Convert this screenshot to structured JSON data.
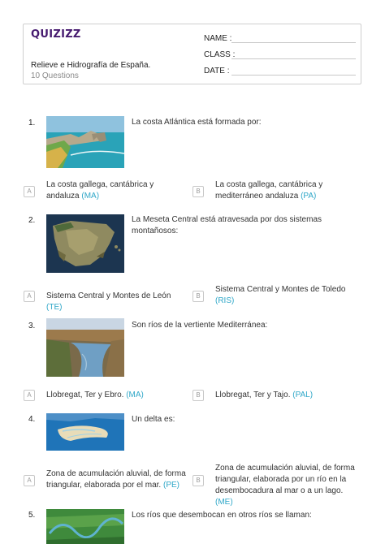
{
  "header": {
    "logo": "QUIZIZZ",
    "title": "Relieve e Hidrografía de España.",
    "subtitle": "10 Questions",
    "fields": {
      "name": "NAME :",
      "class": "CLASS :",
      "date": "DATE  :"
    }
  },
  "questions": [
    {
      "number": "1.",
      "text": "La costa Atlántica está formada por:",
      "image": "coastal-cliff-photo",
      "options": [
        {
          "letter": "A",
          "text": "La costa gallega, cantábrica y andaluza",
          "code": "(MA)"
        },
        {
          "letter": "B",
          "text": "La costa gallega, cantábrica y mediterráneo andaluza",
          "code": "(PA)"
        }
      ]
    },
    {
      "number": "2.",
      "text": "La Meseta Central está atravesada por dos sistemas montañosos:",
      "image": "iberian-peninsula-satellite-map",
      "options": [
        {
          "letter": "A",
          "text": "Sistema Central y Montes de León",
          "code": "(TE)"
        },
        {
          "letter": "B",
          "text": "Sistema Central y Montes de Toledo",
          "code": "(RIS)"
        }
      ]
    },
    {
      "number": "3.",
      "text": "Son ríos de la vertiente Mediterránea:",
      "image": "river-landscape-photo",
      "options": [
        {
          "letter": "A",
          "text": "Llobregat, Ter y Ebro.",
          "code": "(MA)"
        },
        {
          "letter": "B",
          "text": "Llobregat, Ter y Tajo.",
          "code": "(PAL)"
        }
      ]
    },
    {
      "number": "4.",
      "text": "Un delta es:",
      "image": "river-delta-aerial-photo",
      "options": [
        {
          "letter": "A",
          "text": "Zona de acumulación aluvial, de forma triangular, elaborada por el mar.",
          "code": "(PE)"
        },
        {
          "letter": "B",
          "text": "Zona de acumulación aluvial, de forma triangular, elaborada por un río en la desembocadura al mar o a un lago.",
          "code": "(ME)"
        }
      ]
    },
    {
      "number": "5.",
      "text": "Los ríos que desembocan en otros ríos se llaman:",
      "image": "river-meander-aerial-photo",
      "options": []
    }
  ]
}
